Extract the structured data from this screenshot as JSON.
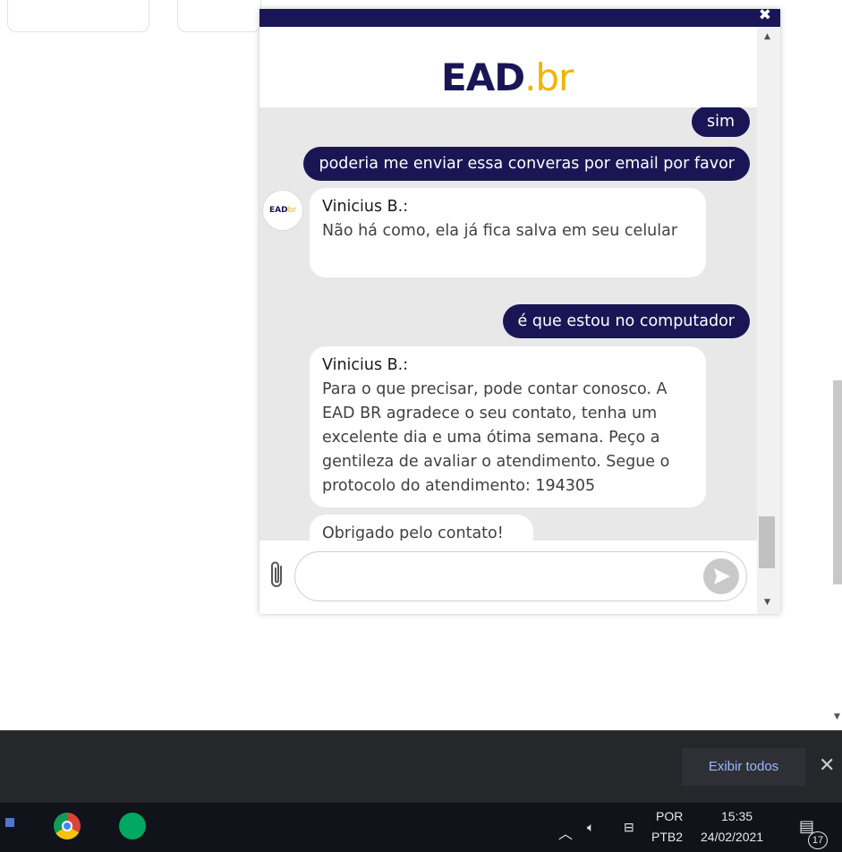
{
  "chat": {
    "close_icon": "close-icon",
    "logo": {
      "part1": "EAD",
      "part2": ".br"
    },
    "messages": [
      {
        "direction": "out",
        "text": "sim"
      },
      {
        "direction": "out",
        "text": "poderia me enviar essa converas por email por favor"
      },
      {
        "direction": "in",
        "sender": "Vinicius  B.:",
        "text": "Não há como, ela já fica salva em seu celular"
      },
      {
        "direction": "out",
        "text": "é que estou no computador"
      },
      {
        "direction": "in",
        "sender": "Vinicius  B.:",
        "text": "Para o que precisar, pode contar conosco. A EAD BR agradece o seu contato, tenha um excelente dia e uma ótima semana. Peço a gentileza de avaliar o atendimento. Segue o protocolo do atendimento: 194305"
      },
      {
        "direction": "in",
        "sender": "",
        "text": "Obrigado pelo contato!"
      }
    ],
    "avatar": {
      "part1": "EAD",
      "part2": "br"
    },
    "input": {
      "placeholder": "",
      "value": ""
    },
    "icons": {
      "attach": "paperclip-icon",
      "send": "send-icon"
    }
  },
  "download_bar": {
    "show_all_label": "Exibir todos",
    "close_icon": "close-icon"
  },
  "taskbar": {
    "language_line1": "POR",
    "language_line2": "PTB2",
    "time": "15:35",
    "date": "24/02/2021",
    "notification_count": "17"
  },
  "colors": {
    "chat_primary": "#1a1656",
    "logo_accent": "#f3b400",
    "chat_background": "#e8e8e8"
  }
}
